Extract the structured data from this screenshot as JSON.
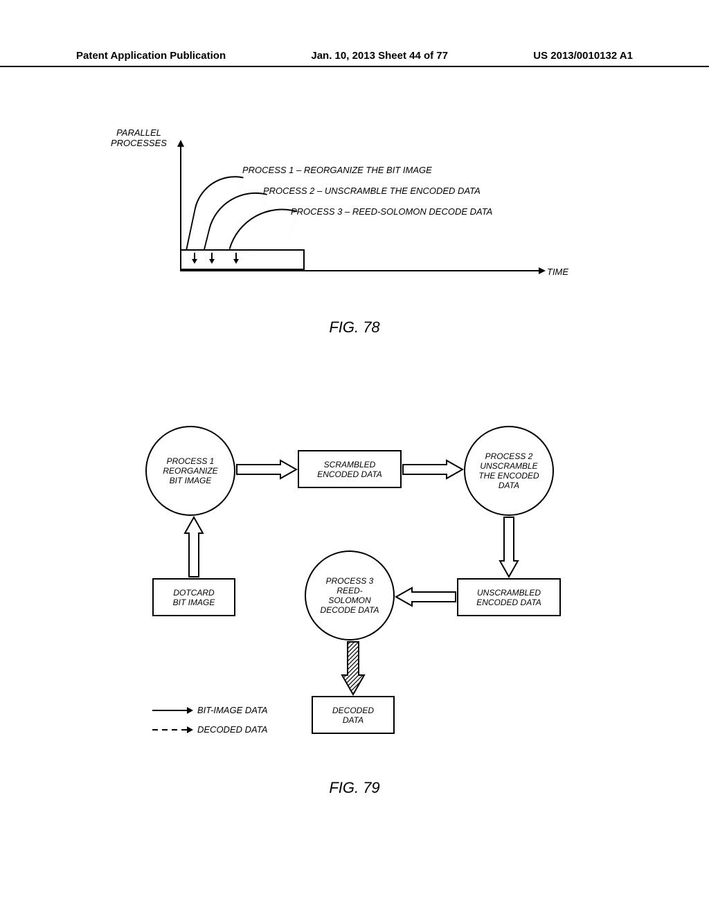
{
  "header": {
    "left": "Patent Application Publication",
    "mid": "Jan. 10, 2013  Sheet 44 of 77",
    "right": "US 2013/0010132 A1"
  },
  "fig78": {
    "yLabel": "PARALLEL\nPROCESSES",
    "xLabel": "TIME",
    "p1": "PROCESS 1 – REORGANIZE THE BIT IMAGE",
    "p2": "PROCESS 2 – UNSCRAMBLE THE ENCODED DATA",
    "p3": "PROCESS 3 – REED-SOLOMON DECODE DATA",
    "caption": "FIG. 78"
  },
  "fig79": {
    "process1": "PROCESS 1\nREORGANIZE\nBIT IMAGE",
    "process2": "PROCESS 2\nUNSCRAMBLE\nTHE ENCODED\nDATA",
    "process3": "PROCESS 3\nREED-\nSOLOMON\nDECODE DATA",
    "dotcard": "DOTCARD\nBIT IMAGE",
    "scrambled": "SCRAMBLED\nENCODED DATA",
    "unscrambled": "UNSCRAMBLED\nENCODED DATA",
    "decoded": "DECODED\nDATA",
    "legendBit": "BIT-IMAGE DATA",
    "legendDec": "DECODED DATA",
    "caption": "FIG. 79"
  }
}
